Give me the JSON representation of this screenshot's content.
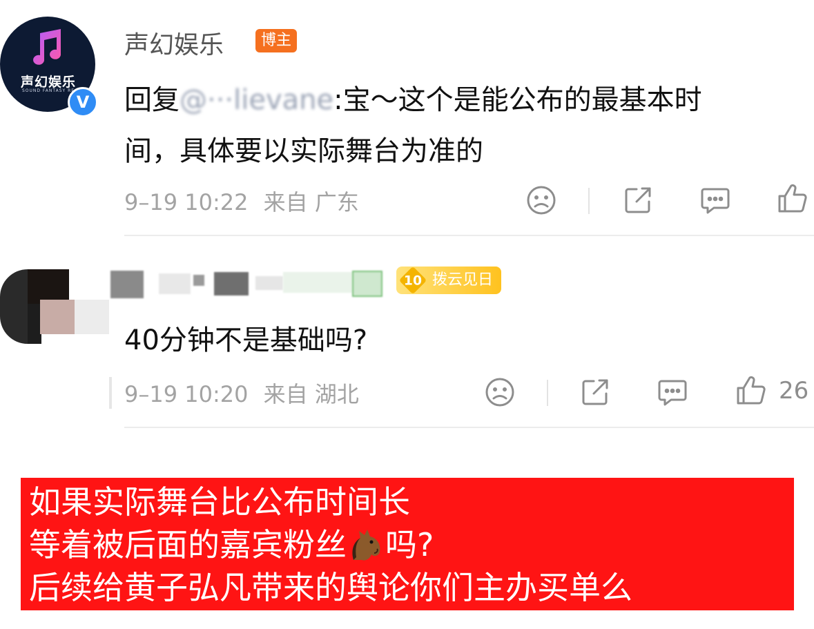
{
  "comment_1": {
    "avatar": {
      "logo_text": "声幻娱乐",
      "logo_subtext": "SOUND FANTASY RE",
      "verified_mark": "V"
    },
    "author": "声幻娱乐",
    "author_badge": "博主",
    "text_prefix": "回复",
    "mention": "@···lievane",
    "text_rest": ":宝～这个是能公布的最基本时",
    "text_line2": "间，具体要以实际舞台为准的",
    "timestamp": "9–19 10:22",
    "source_prefix": "来自",
    "location": "广东",
    "actions": [
      "sad-face",
      "share",
      "comment",
      "like"
    ]
  },
  "comment_2": {
    "fan_badge_level": "10",
    "fan_badge_label": "拨云见日",
    "text": "40分钟不是基础吗?",
    "timestamp": "9–19 10:20",
    "source_prefix": "来自",
    "location": "湖北",
    "like_count": "26"
  },
  "caption": {
    "line1": "如果实际舞台比公布时间长",
    "line2_before": "等着被后面的嘉宾粉丝",
    "line2_after": "吗?",
    "line3": "后续给黄子弘凡带来的舆论你们主办买单么",
    "background": "#ff1414"
  },
  "colors": {
    "blogger_badge": "#f5701f",
    "verified": "#2f8cf5",
    "meta_text": "#a3a3a3"
  }
}
